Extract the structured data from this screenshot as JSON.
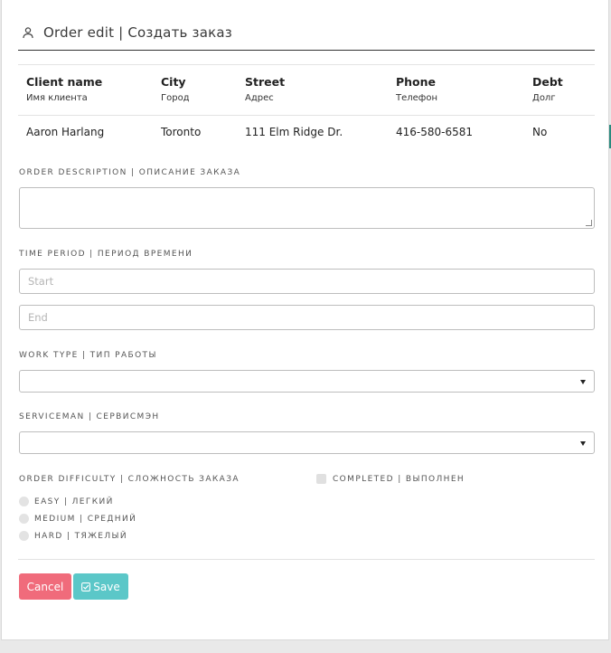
{
  "header": {
    "title": "Order edit | Создать заказ"
  },
  "table": {
    "columns": [
      {
        "label": "Client name",
        "sublabel": "Имя клиента"
      },
      {
        "label": "City",
        "sublabel": "Город"
      },
      {
        "label": "Street",
        "sublabel": "Адрес"
      },
      {
        "label": "Phone",
        "sublabel": "Телефон"
      },
      {
        "label": "Debt",
        "sublabel": "Долг"
      }
    ],
    "rows": [
      [
        "Aaron Harlang",
        "Toronto",
        "111 Elm Ridge Dr.",
        "416-580-6581",
        "No"
      ]
    ]
  },
  "form": {
    "description_label": "Order description | Описание заказа",
    "description_value": "",
    "time_label": "Time period | Период времени",
    "start_placeholder": "Start",
    "end_placeholder": "End",
    "work_type_label": "Work type | Тип работы",
    "work_type_value": "",
    "serviceman_label": "Serviceman | Сервисмэн",
    "serviceman_value": "",
    "difficulty_label": "Order difficulty | Сложность заказа",
    "difficulty_options": [
      "EASY | ЛЕГКИЙ",
      "MEDIUM | СРЕДНИЙ",
      "HARD | ТЯЖЕЛЫЙ"
    ],
    "completed_label": "COMPLETED | ВЫПОЛНЕН"
  },
  "buttons": {
    "cancel": "Cancel",
    "save": "Save"
  },
  "icons": {
    "header": "user-icon",
    "save": "check-square-icon"
  },
  "colors": {
    "cancel": "#f06b7b",
    "save": "#5bc7c8"
  }
}
